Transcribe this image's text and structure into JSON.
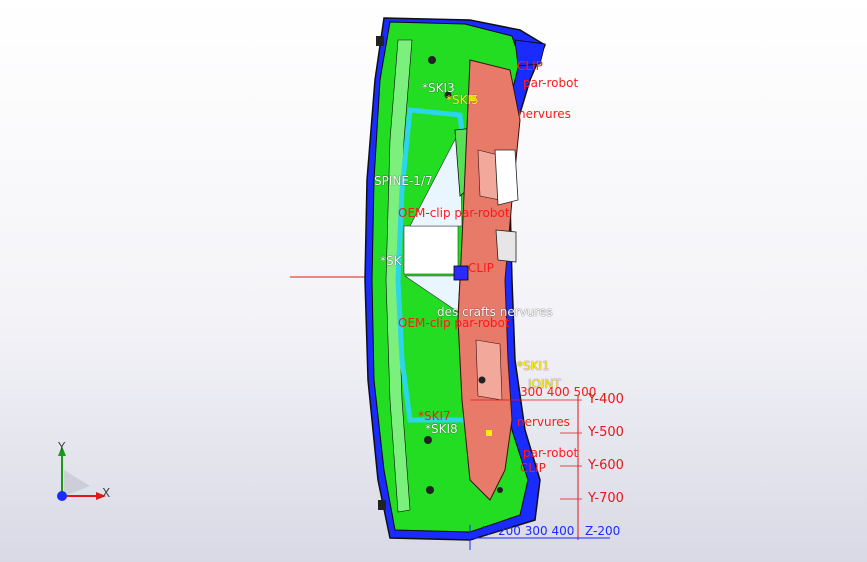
{
  "colors": {
    "background_top": "#ffffff",
    "background_bottom": "#d9d9e6",
    "part_green": "#22dd22",
    "part_salmon": "#e87a6a",
    "part_cyan": "#2ad6e8",
    "part_blue": "#1a2bff",
    "annotation_red": "#ff1a1a",
    "annotation_yellow": "#ffee00"
  },
  "annotations": {
    "clip_top": "CLIP",
    "robot_top": "par-robot",
    "ski_upper_a": "*SKI3",
    "ski_upper_b": "*SKI5",
    "nervures_top": "nervures",
    "spine_upper": "SPINE-1/7",
    "oem_clip_upper": "OEM-clip par-robot",
    "ski_mid": "*SK",
    "clip_mid": "CLIP",
    "nervures_mid": "des crafts nervures",
    "oem_clip_lower": "OEM-clip par-robot",
    "ski_one": "*SKI1",
    "joint_label": "JOINT",
    "ski_lower_a": "*SKI7",
    "ski_lower_b": "*SKI8",
    "nervures_lower": "nervures",
    "robot_lower": "par-robot",
    "clip_lower": "CLIP"
  },
  "y_ruler": {
    "top_numbers": "300 400 500",
    "labels": [
      "Y-400",
      "Y-500",
      "Y-600",
      "Y-700"
    ]
  },
  "x_ruler": {
    "prefix": "X",
    "numbers": "200 300 400",
    "end_label": "Z-200"
  },
  "triad": {
    "x_label": "X",
    "y_label": "Y"
  }
}
